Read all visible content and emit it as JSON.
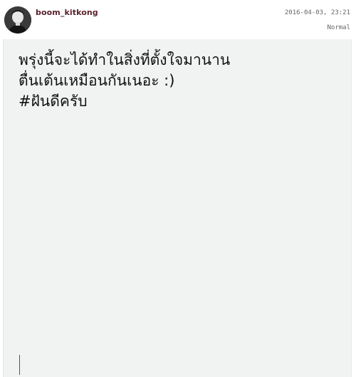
{
  "post": {
    "username": "boom_kitkong",
    "timestamp": "2016-04-03, 23:21",
    "mode": "Normal",
    "lines": [
      "พรุ่งนี้จะได้ทำในสิ่งที่ตั้งใจมานาน",
      "ตื่นเต้นเหมือนกันเนอะ :)",
      "#ฝันดีครับ"
    ]
  },
  "icons": {
    "avatar": "profile-photo"
  }
}
